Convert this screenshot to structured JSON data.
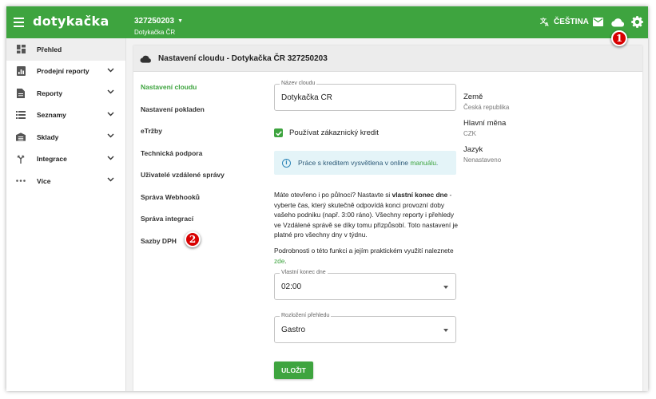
{
  "app": {
    "logo": "dotykačka",
    "account_id": "327250203",
    "account_name": "Dotykačka ČR",
    "language": "ČEŠTINA",
    "accent_color": "#3ea43f"
  },
  "callouts": {
    "one": "1",
    "two": "2"
  },
  "sidebar": {
    "items": [
      {
        "label": "Přehled",
        "icon": "dashboard-icon",
        "active": true
      },
      {
        "label": "Prodejní reporty",
        "icon": "report-icon"
      },
      {
        "label": "Reporty",
        "icon": "document-icon"
      },
      {
        "label": "Seznamy",
        "icon": "list-icon"
      },
      {
        "label": "Sklady",
        "icon": "warehouse-icon"
      },
      {
        "label": "Integrace",
        "icon": "integration-icon"
      },
      {
        "label": "Více",
        "icon": "more-icon"
      }
    ]
  },
  "card": {
    "title": "Nastavení cloudu - Dotykačka ČR 327250203"
  },
  "subnav": {
    "items": [
      {
        "label": "Nastavení cloudu",
        "active": true
      },
      {
        "label": "Nastavení pokladen"
      },
      {
        "label": "eTržby"
      },
      {
        "label": "Technická podpora"
      },
      {
        "label": "Uživatelé vzdálené správy"
      },
      {
        "label": "Správa Webhooků"
      },
      {
        "label": "Správa integrací"
      },
      {
        "label": "Sazby DPH"
      }
    ]
  },
  "form": {
    "cloud_name_label": "Název cloudu",
    "cloud_name_value": "Dotykačka ČR",
    "credit_label": "Používat zákaznický kredit",
    "credit_checked": true,
    "info_text": "Práce s kreditem vysvětlena v online ",
    "info_link": "manuálu",
    "info_period": ".",
    "desc_pre": "Máte otevřeno i po půlnoci? Nastavte si ",
    "desc_bold": "vlastní konec dne",
    "desc_post": " - vyberte čas, který skutečně odpovídá konci provozní doby vašeho podniku (např. 3:00 ráno). Všechny reporty i přehledy ve Vzdálené správě se díky tomu přizpůsobí. Toto nastavení je platné pro všechny dny v týdnu.",
    "desc2_text": "Podrobnosti o této funkci a jejím praktickém využití naleznete ",
    "desc2_link": "zde",
    "desc2_period": ".",
    "day_end_label": "Vlastní konec dne",
    "day_end_value": "02:00",
    "layout_label": "Rozložení přehledu",
    "layout_value": "Gastro",
    "save_label": "ULOŽIT"
  },
  "info": {
    "country_label": "Země",
    "country_value": "Česká republika",
    "currency_label": "Hlavní měna",
    "currency_value": "CZK",
    "language_label": "Jazyk",
    "language_value": "Nenastaveno"
  }
}
